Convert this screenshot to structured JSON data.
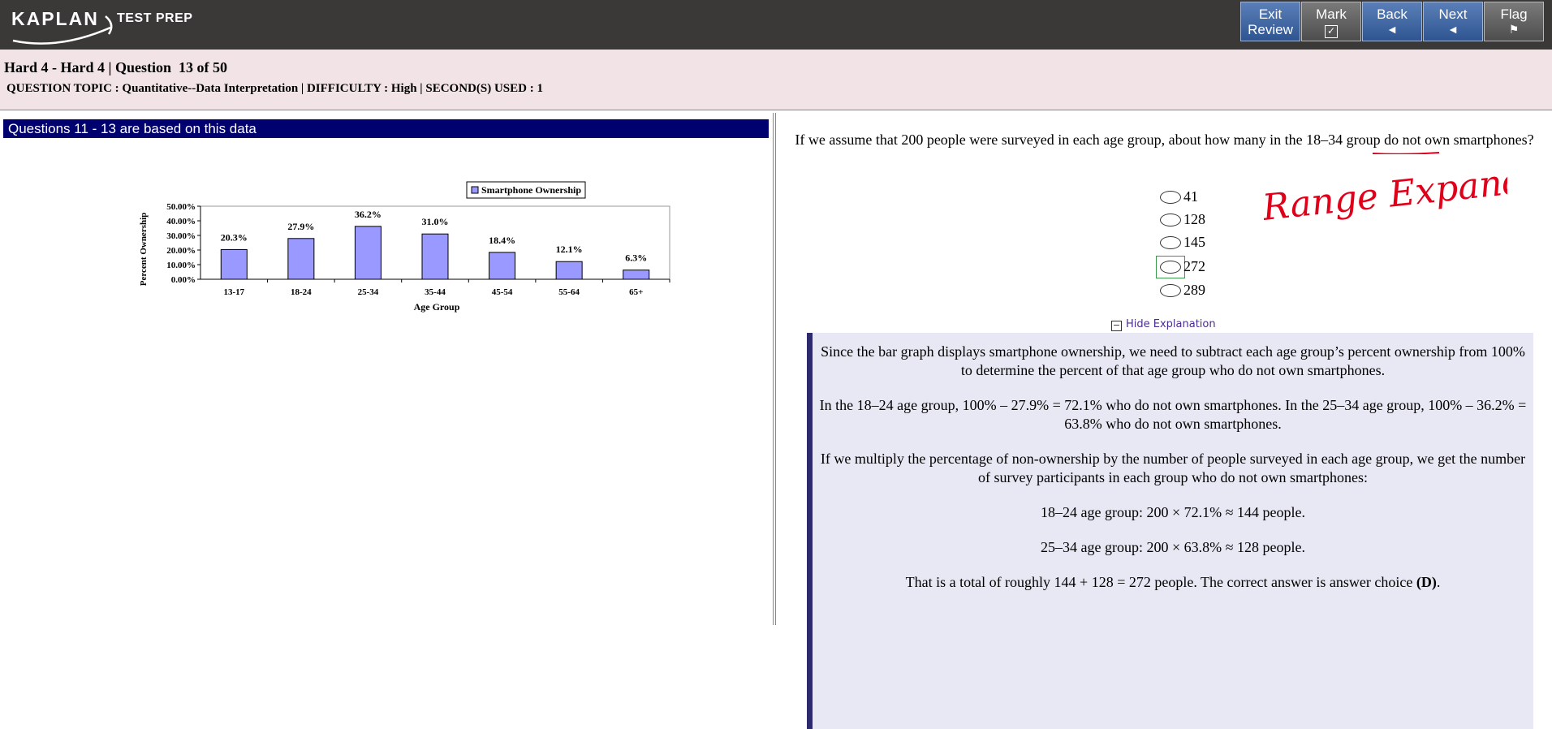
{
  "brand": {
    "logo_text": "KAPLAN",
    "logo_sub": "TEST PREP"
  },
  "nav": {
    "exit_line1": "Exit",
    "exit_line2": "Review",
    "mark": "Mark",
    "mark_glyph": "✓",
    "back": "Back",
    "back_glyph": "◄",
    "next": "Next",
    "next_glyph": "◄",
    "flag": "Flag",
    "flag_glyph": "⚑"
  },
  "header": {
    "title": "Hard 4 - Hard 4 | Question  13 of 50",
    "topic": "QUESTION TOPIC : Quantitative--Data Interpretation | DIFFICULTY : High | SECOND(S) USED : 1"
  },
  "passage": {
    "heading": "Questions 11 - 13 are based on this data"
  },
  "chart_data": {
    "type": "bar",
    "title": "",
    "legend": [
      "Smartphone Ownership"
    ],
    "legend_position": "top-right",
    "categories": [
      "13-17",
      "18-24",
      "25-34",
      "35-44",
      "45-54",
      "55-64",
      "65+"
    ],
    "values": [
      20.3,
      27.9,
      36.2,
      31.0,
      18.4,
      12.1,
      6.3
    ],
    "data_labels": [
      "20.3%",
      "27.9%",
      "36.2%",
      "31.0%",
      "18.4%",
      "12.1%",
      "6.3%"
    ],
    "xlabel": "Age Group",
    "ylabel": "Percent Ownership",
    "ylim": [
      0,
      50
    ],
    "yticks": [
      "0.00%",
      "10.00%",
      "20.00%",
      "30.00%",
      "40.00%",
      "50.00%"
    ],
    "bar_color": "#9999ff",
    "grid": false
  },
  "question": {
    "stem_before": "If we assume that 200 people were surveyed in each age group, about how many in the ",
    "stem_emph": "18–34",
    "stem_after": " group do not own smartphones?",
    "choices": [
      "41",
      "128",
      "145",
      "272",
      "289"
    ],
    "selected_index": 3
  },
  "annotation": {
    "text": "Range Expanded",
    "color": "#e0001a"
  },
  "explanation": {
    "toggle_label": "Hide Explanation",
    "p1": "Since the bar graph displays smartphone ownership, we need to subtract each age group’s percent ownership from 100% to determine the percent of that age group who do not own smartphones.",
    "p2": "In the 18–24 age group, 100% – 27.9% = 72.1% who do not own smartphones. In the 25–34 age group, 100% – 36.2% = 63.8% who do not own smartphones.",
    "p3": "If we multiply the percentage of non-ownership by the number of people surveyed in each age group, we get the number of survey participants in each group who do not own smartphones:",
    "f1": "18–24 age group: 200 × 72.1% ≈ 144 people.",
    "f2": "25–34 age group: 200 × 63.8% ≈ 128 people.",
    "conclusion": "That is a total of roughly 144 + 128 = 272 people. The correct answer is answer choice ",
    "answer": "(D)",
    "period": "."
  }
}
